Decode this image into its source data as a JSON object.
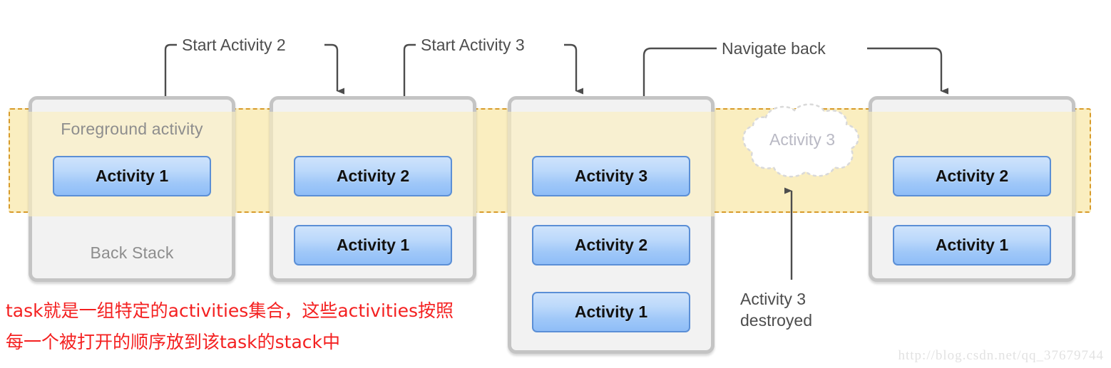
{
  "diagram": {
    "title": "Android task back stack",
    "foreground_band": {
      "band_color": "#faeec0",
      "band_border_color": "#d89b2a"
    },
    "panels": [
      {
        "id": "panel-1",
        "foreground_label": "Foreground activity",
        "backstack_label": "Back Stack",
        "activities": [
          "Activity 1"
        ]
      },
      {
        "id": "panel-2",
        "foreground_label": "",
        "backstack_label": "",
        "activities": [
          "Activity 2",
          "Activity 1"
        ]
      },
      {
        "id": "panel-3",
        "foreground_label": "",
        "backstack_label": "",
        "activities": [
          "Activity 3",
          "Activity 2",
          "Activity 1"
        ]
      },
      {
        "id": "panel-4",
        "foreground_label": "",
        "backstack_label": "",
        "activities": [
          "Activity 2",
          "Activity 1"
        ]
      }
    ],
    "annotations": [
      {
        "id": "start-activity-2",
        "label": "Start Activity 2"
      },
      {
        "id": "start-activity-3",
        "label": "Start Activity 3"
      },
      {
        "id": "navigate-back",
        "label": "Navigate back"
      }
    ],
    "destroyed": {
      "cloud_label": "Activity 3",
      "note_line_1": "Activity 3",
      "note_line_2": "destroyed"
    },
    "caption_cn": {
      "line_1": "task就是一组特定的activities集合，这些activities按照",
      "line_2": "每一个被打开的顺序放到该task的stack中",
      "color": "#f42020"
    },
    "watermark": "http://blog.csdn.net/qq_37679744",
    "colors": {
      "activity_border": "#5b8fd6",
      "activity_fill_top": "#cfe3fb",
      "activity_fill_bottom": "#8fbdf7",
      "panel_border": "#c4c4c4",
      "panel_fill": "#f2f2f2",
      "label_gray": "#8d8d8d",
      "annotation_gray": "#4d4d4d"
    }
  }
}
